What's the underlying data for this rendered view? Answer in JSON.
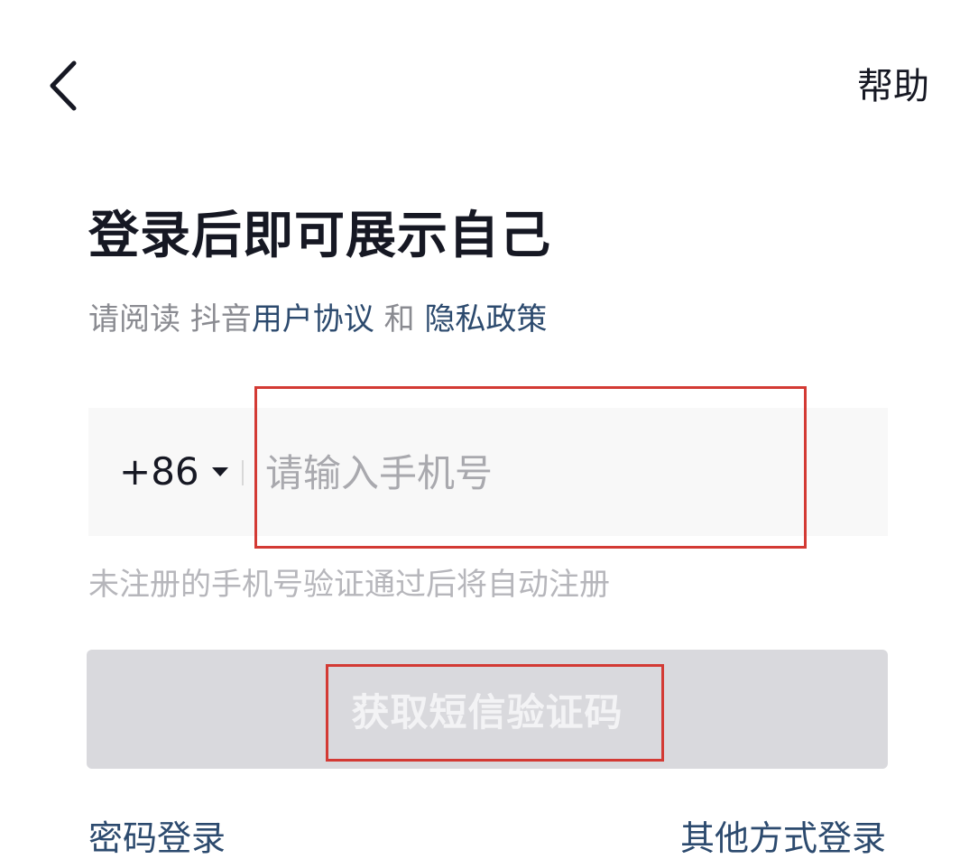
{
  "header": {
    "back_icon": "chevron-left-icon",
    "help_label": "帮助"
  },
  "main": {
    "title": "登录后即可展示自己",
    "agreement": {
      "prefix": "请阅读 抖音",
      "user_agreement": "用户协议",
      "conjunction": " 和 ",
      "privacy_policy": "隐私政策"
    },
    "phone": {
      "country_code": "+86",
      "placeholder": "请输入手机号",
      "value": ""
    },
    "hint": "未注册的手机号验证通过后将自动注册",
    "sms_button_label": "获取短信验证码",
    "password_login": "密码登录",
    "other_login": "其他方式登录"
  },
  "colors": {
    "text_primary": "#161823",
    "text_secondary": "#8a8b91",
    "link": "#2c4a6e",
    "input_bg": "#f8f8f8",
    "button_disabled_bg": "#d9d9dd",
    "annotation_red": "#d33a34"
  }
}
